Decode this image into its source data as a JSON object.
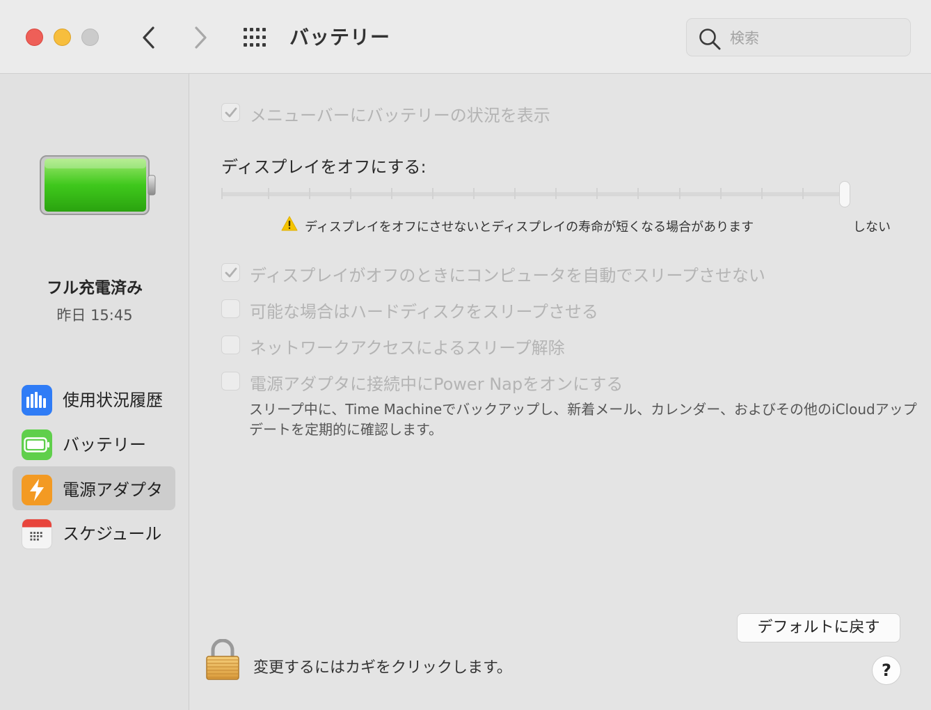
{
  "window": {
    "title": "バッテリー"
  },
  "search": {
    "placeholder": "検索"
  },
  "sidebar": {
    "charge_status": "フル充電済み",
    "charge_time": "昨日 15:45",
    "battery_level_percent": 100,
    "items": [
      {
        "label": "使用状況履歴",
        "icon": "bar-chart-icon",
        "selected": false
      },
      {
        "label": "バッテリー",
        "icon": "battery-icon",
        "selected": false
      },
      {
        "label": "電源アダプタ",
        "icon": "lightning-bolt-icon",
        "selected": true
      },
      {
        "label": "スケジュール",
        "icon": "calendar-icon",
        "selected": false
      }
    ]
  },
  "main": {
    "show_in_menubar": {
      "label": "メニューバーにバッテリーの状況を表示",
      "checked": true
    },
    "display_off": {
      "label": "ディスプレイをオフにする:",
      "slider_value": "never",
      "warning": "ディスプレイをオフにさせないとディスプレイの寿命が短くなる場合があります",
      "never_label": "しない"
    },
    "options": [
      {
        "label": "ディスプレイがオフのときにコンピュータを自動でスリープさせない",
        "checked": true
      },
      {
        "label": "可能な場合はハードディスクをスリープさせる",
        "checked": false
      },
      {
        "label": "ネットワークアクセスによるスリープ解除",
        "checked": false
      },
      {
        "label": "電源アダプタに接続中にPower Napをオンにする",
        "checked": false
      }
    ],
    "power_nap_help": "スリープ中に、Time Machineでバックアップし、新着メール、カレンダー、およびその他のiCloudアップデートを定期的に確認します。",
    "restore_defaults": "デフォルトに戻す",
    "lock_text": "変更するにはカギをクリックします。",
    "help_button": "?"
  },
  "colors": {
    "close": "#ee5f58",
    "minimize": "#f7be3d",
    "zoom": "#cbcbcb",
    "battery_green": "#4cd137",
    "warning_yellow": "#f5c400",
    "adapter_orange": "#f39a23",
    "usage_blue": "#2f7cf6"
  }
}
